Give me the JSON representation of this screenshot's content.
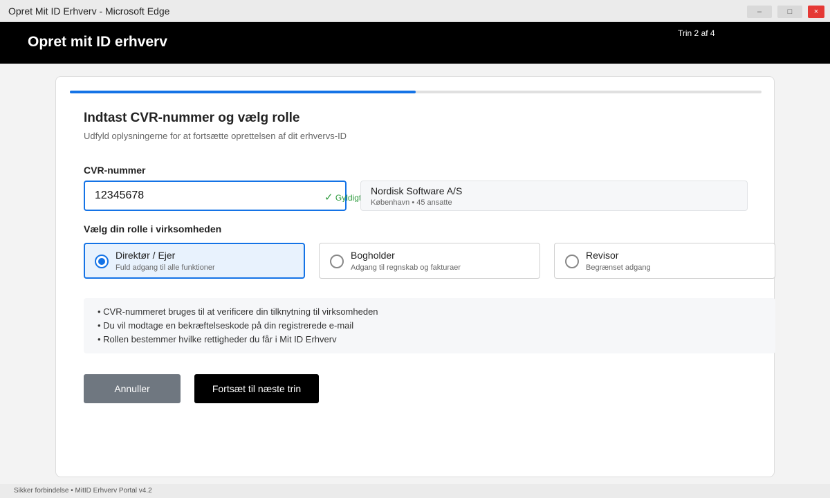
{
  "window": {
    "title": "Opret Mit ID Erhverv - Microsoft Edge",
    "minimize": "–",
    "maximize": "□",
    "close": "×"
  },
  "header": {
    "title": "Opret mit ID erhverv",
    "step": "Trin 2 af 4"
  },
  "progress": {
    "current_step": 2,
    "total_steps": 4,
    "fraction": 0.5
  },
  "form": {
    "heading": "Indtast CVR-nummer og vælg rolle",
    "subheading": "Udfyld oplysningerne for at fortsætte oprettelsen af dit erhvervs-ID",
    "cvr": {
      "label": "CVR-nummer",
      "value": "12345678",
      "valid_check": "✓",
      "valid_text": "Gyldigt"
    },
    "company": {
      "name": "Nordisk Software A/S",
      "meta": "København • 45 ansatte"
    },
    "role_label": "Vælg din rolle i virksomheden",
    "roles": [
      {
        "name": "Direktør / Ejer",
        "desc": "Fuld adgang til alle funktioner",
        "selected": true
      },
      {
        "name": "Bogholder",
        "desc": "Adgang til regnskab og fakturaer",
        "selected": false
      },
      {
        "name": "Revisor",
        "desc": "Begrænset adgang",
        "selected": false
      }
    ],
    "info": [
      "• CVR-nummeret bruges til at verificere din tilknytning til virksomheden",
      "• Du vil modtage en bekræftelseskode på din registrerede e-mail",
      "• Rollen bestemmer hvilke rettigheder du får i Mit ID Erhverv"
    ],
    "cancel_label": "Annuller",
    "next_label": "Fortsæt til næste trin"
  },
  "status": "Sikker forbindelse • MitID Erhverv Portal v4.2",
  "colors": {
    "accent": "#1473e6",
    "header_bg": "#000000",
    "valid": "#2e9b3e",
    "cancel_bg": "#6f7780"
  }
}
